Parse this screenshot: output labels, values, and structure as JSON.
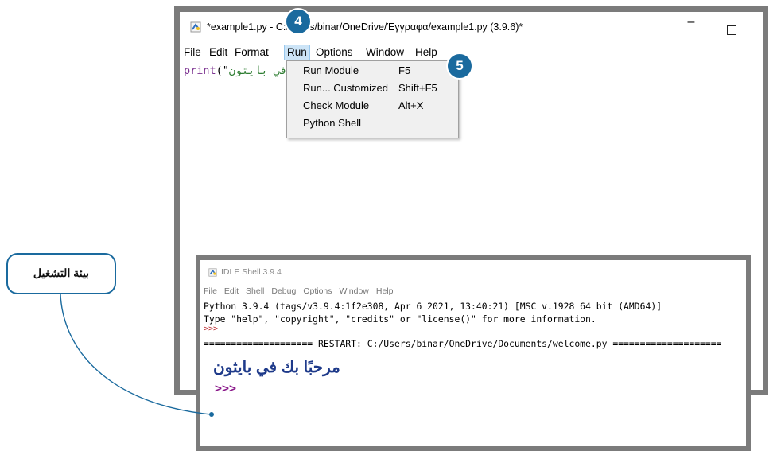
{
  "editor": {
    "title": "*example1.py - C:/Users/binar/OneDrive/Έγγραφα/example1.py (3.9.6)*",
    "minimize_glyph": "–",
    "menu": [
      "File",
      "Edit",
      "Format",
      "Run",
      "Options",
      "Window",
      "Help"
    ],
    "code": {
      "keyword": "print",
      "open": "(\"",
      "string": "مرحبًا بك في بايثون"
    }
  },
  "run_menu": {
    "items": [
      {
        "label": "Run Module",
        "shortcut": "F5"
      },
      {
        "label": "Run... Customized",
        "shortcut": "Shift+F5"
      },
      {
        "label": "Check Module",
        "shortcut": "Alt+X"
      },
      {
        "label": "Python Shell",
        "shortcut": ""
      }
    ]
  },
  "badges": {
    "step4": "4",
    "step5": "5"
  },
  "shell": {
    "title": "IDLE Shell 3.9.4",
    "minimize_glyph": "–",
    "menu": [
      "File",
      "Edit",
      "Shell",
      "Debug",
      "Options",
      "Window",
      "Help"
    ],
    "lines": [
      "Python 3.9.4 (tags/v3.9.4:1f2e308, Apr  6 2021, 13:40:21) [MSC v.1928 64 bit (AMD64)]",
      "Type \"help\", \"copyright\", \"credits\" or \"license()\" for more information.",
      ">>>",
      "==================== RESTART: C:/Users/binar/OneDrive/Documents/welcome.py ===================="
    ],
    "output": "مرحبًا بك في بايثون",
    "prompt": ">>>"
  },
  "callout": {
    "label": "بيئة التشغيل"
  },
  "colors": {
    "accent": "#1a6a9e",
    "frame": "#7b7b7b",
    "menu_highlight": "#cce4f7"
  }
}
